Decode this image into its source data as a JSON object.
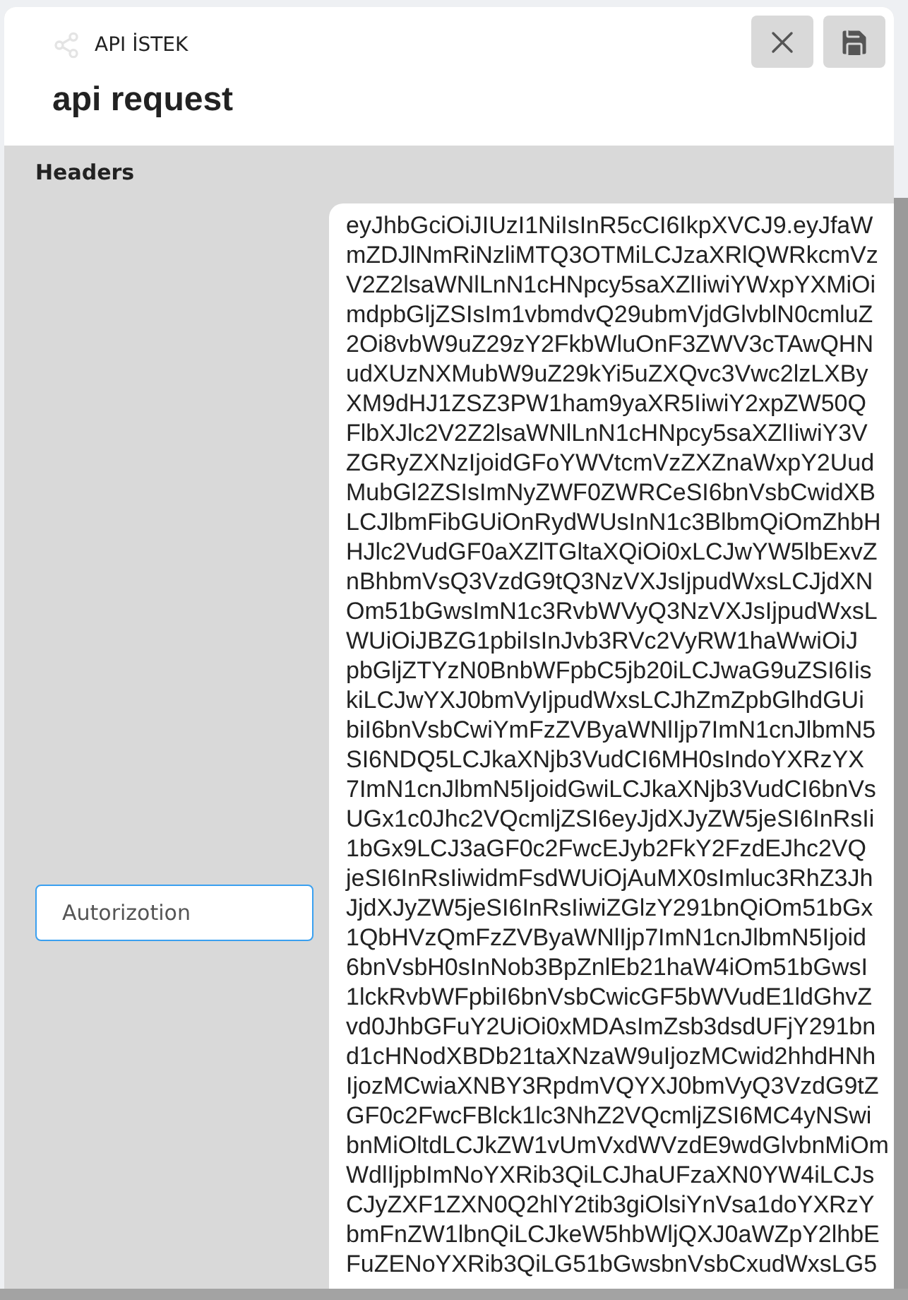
{
  "header": {
    "breadcrumb": "API İSTEK",
    "title": "api request"
  },
  "section": {
    "title": "Headers"
  },
  "header_field": {
    "value": "Autorizotion",
    "focused": true
  },
  "value_lines": [
    "eyJhbGciOiJIUzI1NiIsInR5cCI6IkpXVCJ9.eyJfaW",
    "mZDJlNmRiNzliMTQ3OTMiLCJzaXRlQWRkcmVz",
    "V2Z2lsaWNlLnN1cHNpcy5saXZlIiwiYWxpYXMiOi",
    "mdpbGljZSIsIm1vbmdvQ29ubmVjdGlvblN0cmluZ",
    "2Oi8vbW9uZ29zY2FkbWluOnF3ZWV3cTAwQHN",
    "udXUzNXMubW9uZ29kYi5uZXQvc3Vwc2lzLXBy",
    "XM9dHJ1ZSZ3PW1ham9yaXR5IiwiY2xpZW50Q",
    "FlbXJlc2V2Z2lsaWNlLnN1cHNpcy5saXZlIiwiY3V",
    "ZGRyZXNzIjoidGFoYWVtcmVzZXZnaWxpY2Uud",
    "MubGl2ZSIsImNyZWF0ZWRCeSI6bnVsbCwidXB",
    "LCJlbmFibGUiOnRydWUsInN1c3BlbmQiOmZhbH",
    "HJlc2VudGF0aXZlTGltaXQiOi0xLCJwYW5lbExvZ",
    "nBhbmVsQ3VzdG9tQ3NzVXJsIjpudWxsLCJjdXN",
    "Om51bGwsImN1c3RvbWVyQ3NzVXJsIjpudWxsL",
    "WUiOiJBZG1pbiIsInJvb3RVc2VyRW1haWwiOiJ",
    "pbGljZTYzN0BnbWFpbC5jb20iLCJwaG9uZSI6Iis",
    "kiLCJwYXJ0bmVyIjpudWxsLCJhZmZpbGlhdGUi",
    "biI6bnVsbCwiYmFzZVByaWNlIjp7ImN1cnJlbmN5",
    "SI6NDQ5LCJkaXNjb3VudCI6MH0sIndoYXRzYX",
    "7ImN1cnJlbmN5IjoidGwiLCJkaXNjb3VudCI6bnVs",
    "UGx1c0Jhc2VQcmljZSI6eyJjdXJyZW5jeSI6InRsIi",
    "1bGx9LCJ3aGF0c2FwcEJyb2FkY2FzdEJhc2VQ",
    "jeSI6InRsIiwidmFsdWUiOjAuMX0sImluc3RhZ3Jh",
    "JjdXJyZW5jeSI6InRsIiwiZGlzY291bnQiOm51bGx",
    "1QbHVzQmFzZVByaWNlIjp7ImN1cnJlbmN5Ijoid",
    "6bnVsbH0sInNob3BpZnlEb21haW4iOm51bGwsI",
    "1lckRvbWFpbiI6bnVsbCwicGF5bWVudE1ldGhvZ",
    "vd0JhbGFuY2UiOi0xMDAsImZsb3dsdUFjY291bn",
    "d1cHNodXBDb21taXNzaW9uIjozMCwid2hhdHNh",
    "IjozMCwiaXNBY3RpdmVQYXJ0bmVyQ3VzdG9tZ",
    "GF0c2FwcFBlck1lc3NhZ2VQcmljZSI6MC4yNSwi",
    "bnMiOltdLCJkZW1vUmVxdWVzdE9wdGlvbnMiOm",
    "WdlIjpbImNoYXRib3QiLCJhaUFzaXN0YW4iLCJs",
    "CJyZXF1ZXN0Q2hlY2tib3giOlsiYnVsa1doYXRzY",
    "bmFnZW1lbnQiLCJkeW5hbWljQXJ0aWZpY2lhbE",
    "FuZENoYXRib3QiLG51bGwsbnVsbCxudWxsLG5"
  ]
}
